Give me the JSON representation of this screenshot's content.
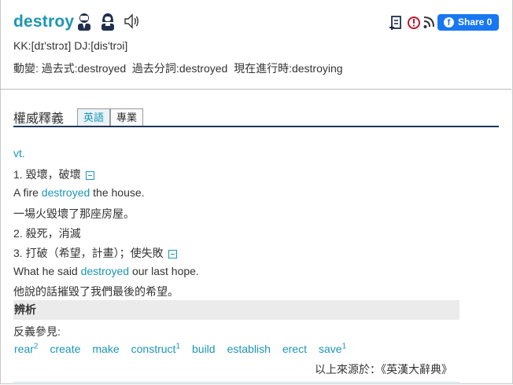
{
  "header": {
    "word": "destroy",
    "pron": "KK:[dɪ'strɔɪ] DJ:[dis'trɔi]",
    "inflections": "動變: 過去式:destroyed  過去分詞:destroyed  現在進行時:destroying",
    "icons": [
      "male-voice-icon",
      "female-voice-icon",
      "speaker-icon",
      "add-wordbook-icon",
      "report-icon",
      "rss-icon"
    ],
    "share_label": "Share 0",
    "share_icon": "f"
  },
  "section": {
    "title": "權威釋義",
    "tabs": [
      {
        "label": "英語",
        "active": true
      },
      {
        "label": "專業",
        "active": false
      }
    ]
  },
  "entry": {
    "pos": "vt.",
    "senses": [
      {
        "def": "1. 毀壞，破壞",
        "example_before": "A fire ",
        "example_key": "destroyed",
        "example_after": " the house.",
        "translation": "一場火毀壞了那座房屋。"
      },
      {
        "def": "2. 殺死，消滅"
      },
      {
        "def": "3. 打破（希望，計畫）；使失敗",
        "example_before": "What he said ",
        "example_key": "destroyed",
        "example_after": " our last hope.",
        "translation": "他說的話摧毀了我們最後的希望。"
      }
    ],
    "analysis_heading": "辨析",
    "antonym_label": "反義參見:",
    "antonyms": [
      {
        "word": "rear",
        "sup": "2"
      },
      {
        "word": "create",
        "sup": ""
      },
      {
        "word": "make",
        "sup": ""
      },
      {
        "word": "construct",
        "sup": "1"
      },
      {
        "word": "build",
        "sup": ""
      },
      {
        "word": "establish",
        "sup": ""
      },
      {
        "word": "erect",
        "sup": ""
      },
      {
        "word": "save",
        "sup": "1"
      }
    ],
    "source": "以上來源於：《英漢大辭典》"
  },
  "colors": {
    "accent": "#1c96b4",
    "rule": "#1d3557",
    "facebook": "#1877f2"
  }
}
